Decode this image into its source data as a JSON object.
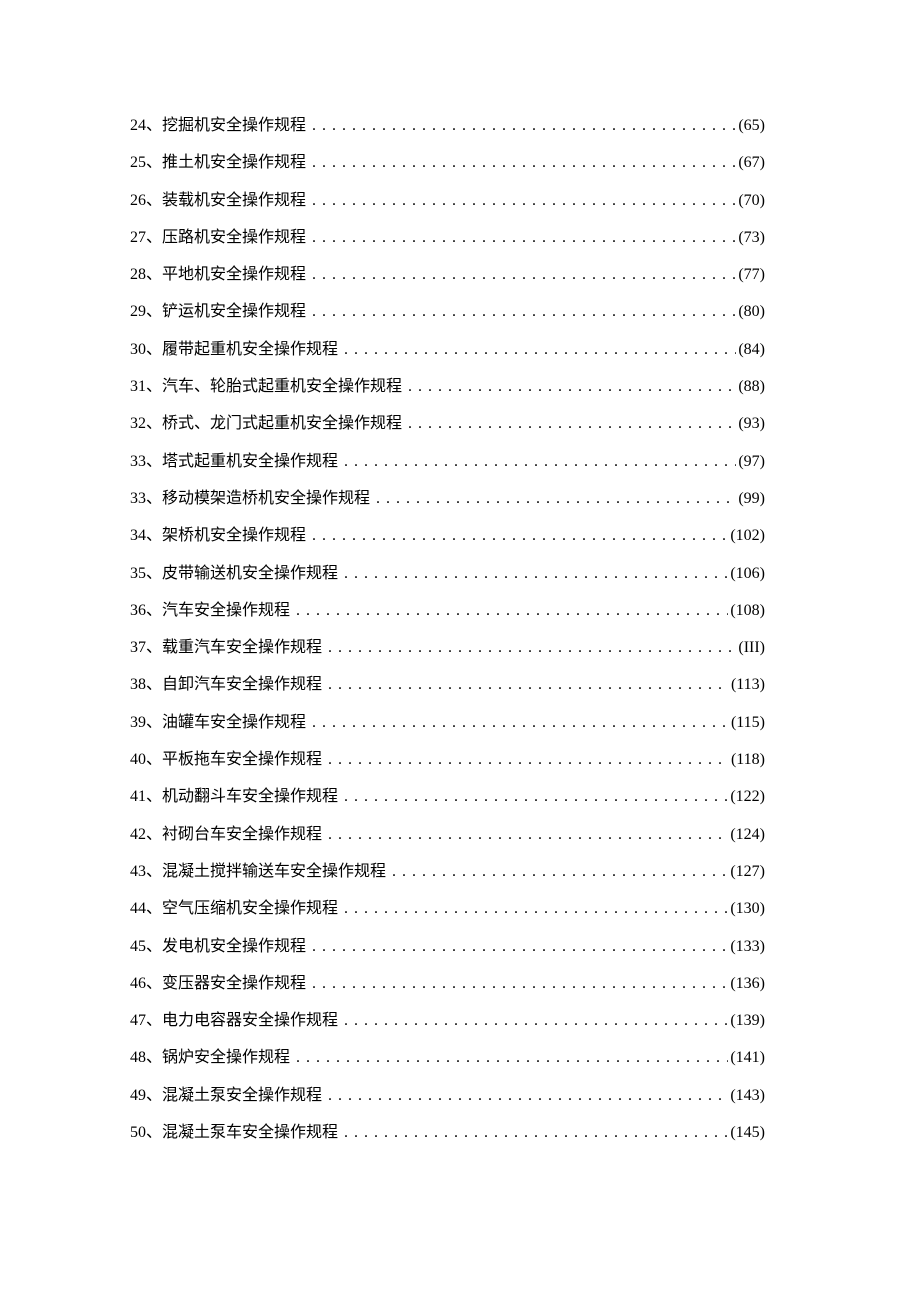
{
  "toc": [
    {
      "num": "24、",
      "title": "挖掘机安全操作规程",
      "page": "(65)"
    },
    {
      "num": "25、",
      "title": "推土机安全操作规程",
      "page": "(67)"
    },
    {
      "num": "26、",
      "title": "装载机安全操作规程",
      "page": "(70)"
    },
    {
      "num": "27、",
      "title": "压路机安全操作规程",
      "page": "(73)"
    },
    {
      "num": "28、",
      "title": "平地机安全操作规程",
      "page": "(77)"
    },
    {
      "num": "29、",
      "title": "铲运机安全操作规程",
      "page": "(80)"
    },
    {
      "num": "30、",
      "title": "履带起重机安全操作规程",
      "page": "(84)"
    },
    {
      "num": "31、",
      "title": "汽车、轮胎式起重机安全操作规程",
      "page": "(88)"
    },
    {
      "num": "32、",
      "title": "桥式、龙门式起重机安全操作规程",
      "page": "(93)"
    },
    {
      "num": "33、",
      "title": "塔式起重机安全操作规程",
      "page": "(97)"
    },
    {
      "num": "33、",
      "title": "移动模架造桥机安全操作规程",
      "page": "(99)"
    },
    {
      "num": "34、",
      "title": "架桥机安全操作规程",
      "page": "(102)"
    },
    {
      "num": "35、",
      "title": "皮带输送机安全操作规程",
      "page": "(106)"
    },
    {
      "num": "36、",
      "title": "汽车安全操作规程",
      "page": "(108)"
    },
    {
      "num": "37、",
      "title": "载重汽车安全操作规程",
      "page": "(III)"
    },
    {
      "num": "38、",
      "title": "自卸汽车安全操作规程",
      "page": "(113)"
    },
    {
      "num": "39、",
      "title": "油罐车安全操作规程",
      "page": "(115)"
    },
    {
      "num": "40、",
      "title": "平板拖车安全操作规程",
      "page": "(118)"
    },
    {
      "num": "41、",
      "title": "机动翻斗车安全操作规程",
      "page": "(122)"
    },
    {
      "num": "42、",
      "title": "衬砌台车安全操作规程",
      "page": "(124)"
    },
    {
      "num": "43、",
      "title": "混凝土搅拌输送车安全操作规程",
      "page": "(127)"
    },
    {
      "num": "44、",
      "title": "空气压缩机安全操作规程",
      "page": "(130)"
    },
    {
      "num": "45、",
      "title": "发电机安全操作规程",
      "page": "(133)"
    },
    {
      "num": "46、",
      "title": "变压器安全操作规程",
      "page": "(136)"
    },
    {
      "num": "47、",
      "title": "电力电容器安全操作规程",
      "page": "(139)"
    },
    {
      "num": "48、",
      "title": "锅炉安全操作规程",
      "page": "(141)"
    },
    {
      "num": "49、",
      "title": "混凝土泵安全操作规程",
      "page": "(143)"
    },
    {
      "num": "50、",
      "title": "混凝土泵车安全操作规程",
      "page": "(145)"
    }
  ]
}
